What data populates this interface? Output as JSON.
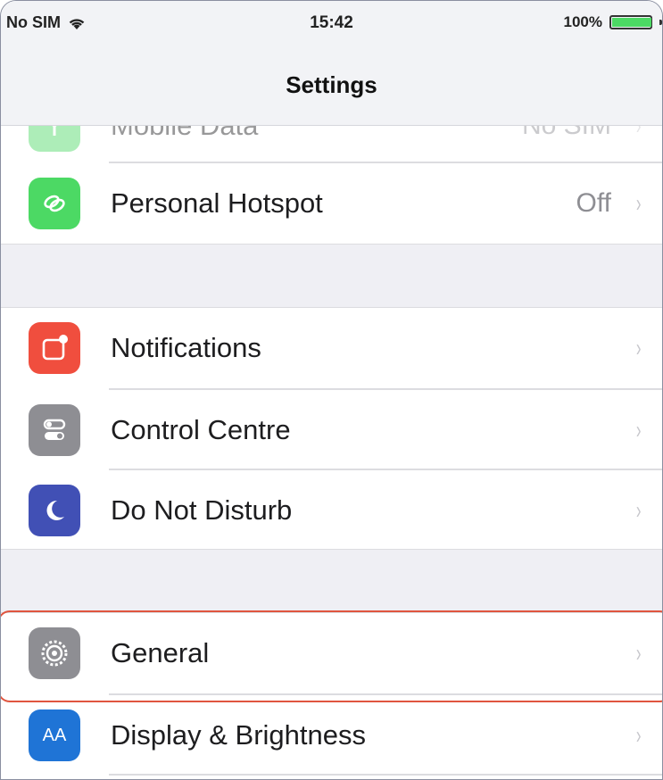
{
  "status_bar": {
    "carrier": "No SIM",
    "time": "15:42",
    "battery": "100%"
  },
  "nav": {
    "title": "Settings"
  },
  "rows": {
    "mobile_data": {
      "label": "Mobile Data",
      "value": "No SIM"
    },
    "personal_hotspot": {
      "label": "Personal Hotspot",
      "value": "Off"
    },
    "notifications": {
      "label": "Notifications"
    },
    "control_centre": {
      "label": "Control Centre"
    },
    "do_not_disturb": {
      "label": "Do Not Disturb"
    },
    "general": {
      "label": "General"
    },
    "display_brightness": {
      "label": "Display & Brightness",
      "icon_text": "AA"
    }
  },
  "chevron": "›",
  "colors": {
    "hotspot": "#4cd964",
    "notifications": "#f04e3e",
    "control_centre": "#8e8e93",
    "do_not_disturb": "#4150b5",
    "general": "#8e8e93",
    "display": "#1f74d6",
    "highlight": "#e0553f"
  }
}
